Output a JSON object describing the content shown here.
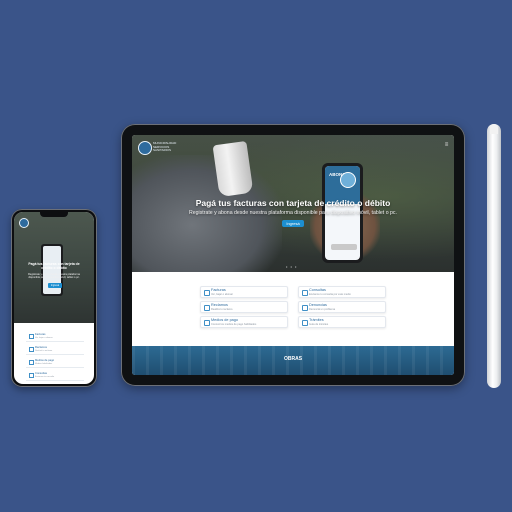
{
  "tablet": {
    "logo_lines": [
      "MUNICIPALIDAD",
      "SERVICIOS",
      "SANITARIOS"
    ],
    "menu_icon": "hamburger-icon",
    "hero": {
      "title": "Pagá tus facturas con tarjeta de crédito o débito",
      "subtitle": "Registrate y abona desde nuestra plataforma disponible para dispositivo móvil, tablet o pc.",
      "cta_label": "Ingresá",
      "carousel_indicator": "• • •",
      "phone_logo": "ABONO"
    },
    "cards": [
      {
        "icon": "document-icon",
        "title": "Facturas",
        "desc": "Ver, bajar o abonar"
      },
      {
        "icon": "chat-icon",
        "title": "Consultas",
        "desc": "Envianos tu consulta por este medio"
      },
      {
        "icon": "phone-icon",
        "title": "Reclamos",
        "desc": "Realizá tu reclamo"
      },
      {
        "icon": "people-icon",
        "title": "Denuncias",
        "desc": "Denunciá un problema"
      },
      {
        "icon": "card-icon",
        "title": "Medios de pago",
        "desc": "Conocé los medios de pago habilitados"
      },
      {
        "icon": "calendar-icon",
        "title": "Trámites",
        "desc": "Guía de trámites"
      }
    ],
    "obras_label": "OBRAS"
  },
  "phone": {
    "hero": {
      "title": "Pagá tus facturas con tarjeta de crédito o débito",
      "subtitle": "Registrate y abona desde nuestra plataforma disponible para dispositivo móvil, tablet o pc.",
      "cta_label": "Ingresá"
    },
    "cards": [
      {
        "title": "Facturas",
        "desc": "Ver, bajar o abonar"
      },
      {
        "title": "Reclamos",
        "desc": "Realizá tu reclamo"
      },
      {
        "title": "Medios de pago",
        "desc": "Medios habilitados"
      },
      {
        "title": "Consultas",
        "desc": "Envianos tu consulta"
      }
    ]
  },
  "colors": {
    "background": "#3a5489",
    "accent": "#1d8fd1",
    "brand": "#2e6b9e"
  }
}
